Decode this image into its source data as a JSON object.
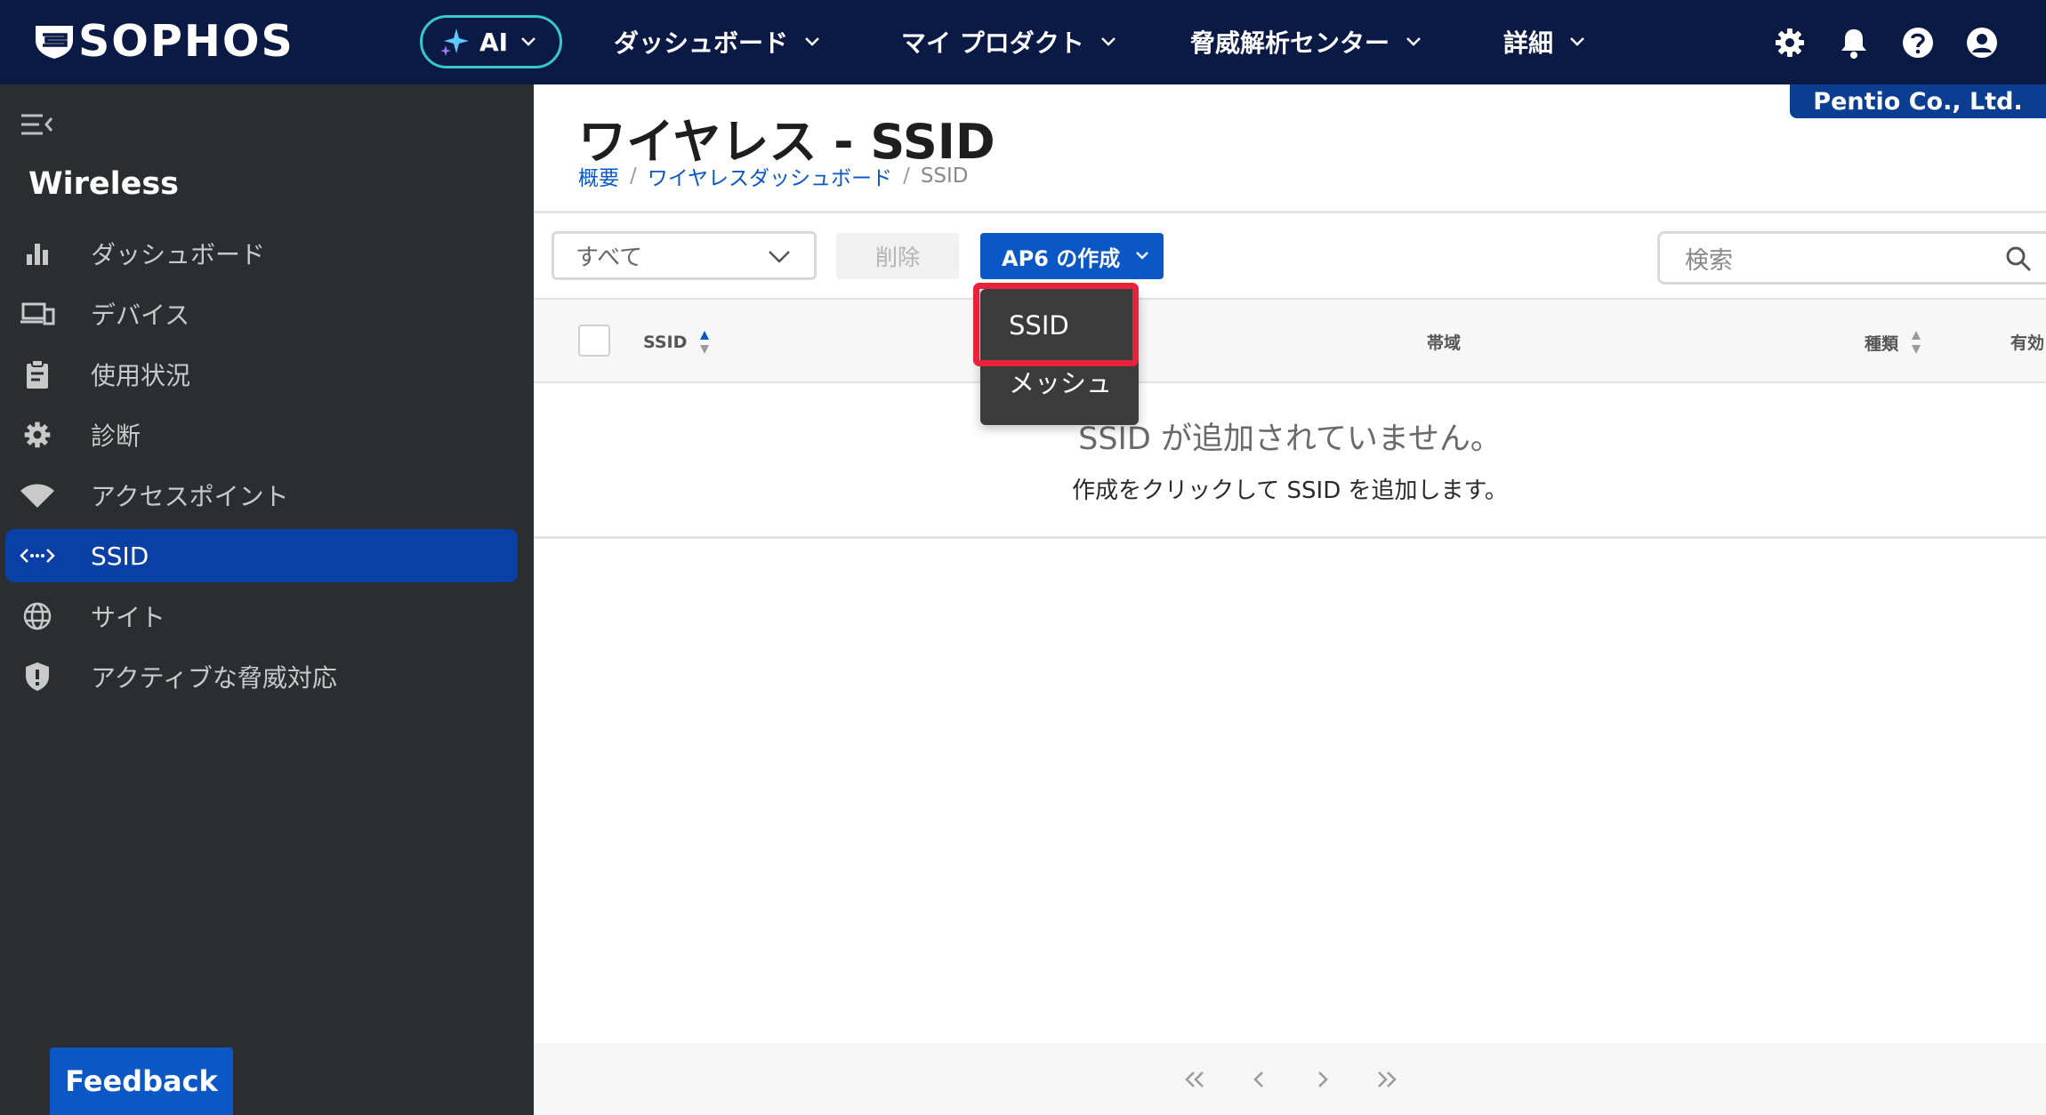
{
  "brand": {
    "name": "SOPHOS"
  },
  "topnav": {
    "ai_label": "AI",
    "items": [
      "ダッシュボード",
      "マイ プロダクト",
      "脅威解析センター",
      "詳細"
    ]
  },
  "tenant": "Pentio Co., Ltd.",
  "sidebar": {
    "title": "Wireless",
    "items": [
      {
        "label": "ダッシュボード",
        "icon": "bar-chart-icon"
      },
      {
        "label": "デバイス",
        "icon": "devices-icon"
      },
      {
        "label": "使用状況",
        "icon": "clipboard-icon"
      },
      {
        "label": "診断",
        "icon": "gear-icon"
      },
      {
        "label": "アクセスポイント",
        "icon": "wifi-icon"
      },
      {
        "label": "SSID",
        "icon": "ssid-icon",
        "active": true
      },
      {
        "label": "サイト",
        "icon": "globe-icon"
      },
      {
        "label": "アクティブな脅威対応",
        "icon": "shield-icon"
      }
    ],
    "feedback": "Feedback"
  },
  "page": {
    "title": "ワイヤレス - SSID",
    "breadcrumb": [
      "概要",
      "ワイヤレスダッシュボード",
      "SSID"
    ]
  },
  "toolbar": {
    "filter_value": "すべて",
    "delete_label": "削除",
    "create_label": "AP6 の作成",
    "search_placeholder": "検索"
  },
  "dropdown": {
    "items": [
      "SSID",
      "メッシュ"
    ],
    "highlighted": "SSID"
  },
  "table": {
    "columns": [
      "SSID",
      "帯域",
      "種類",
      "有効"
    ]
  },
  "empty": {
    "title": "SSID が追加されていません。",
    "subtitle": "作成をクリックして SSID を追加します。"
  },
  "colors": {
    "topbar": "#0b1a45",
    "accent": "#0b57c6",
    "sidebar": "#2b2d30",
    "highlight": "#e8223a"
  }
}
